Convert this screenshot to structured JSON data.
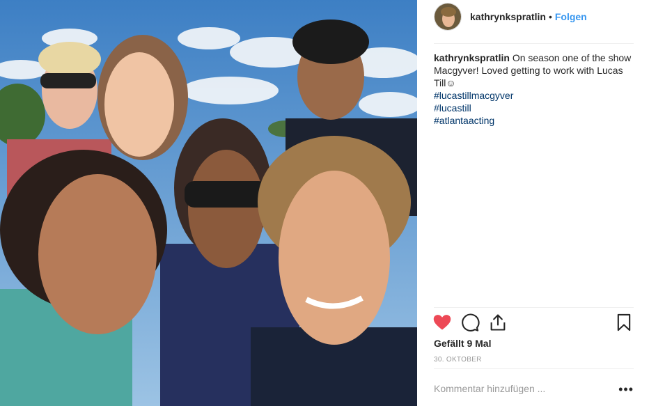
{
  "post": {
    "username": "kathrynkspratlin",
    "separator": "•",
    "follow_label": "Folgen",
    "caption": {
      "username": "kathrynkspratlin",
      "text": "On season one of the show Macgyver! Loved getting to work with Lucas Till☺",
      "hashtags": [
        "#lucastillmacgyver",
        "#lucastill",
        "#atlantaacting"
      ]
    },
    "likes": "Gefällt 9 Mal",
    "date": "30. OKTOBER",
    "comment_placeholder": "Kommentar hinzufügen ...",
    "more_label": "•••"
  },
  "icons": {
    "like": "heart-icon",
    "comment": "speech-bubble-icon",
    "share": "share-icon",
    "save": "bookmark-icon"
  },
  "colors": {
    "accent": "#3897f0",
    "hashtag": "#003569",
    "like": "#ed4956",
    "muted": "#999999"
  }
}
